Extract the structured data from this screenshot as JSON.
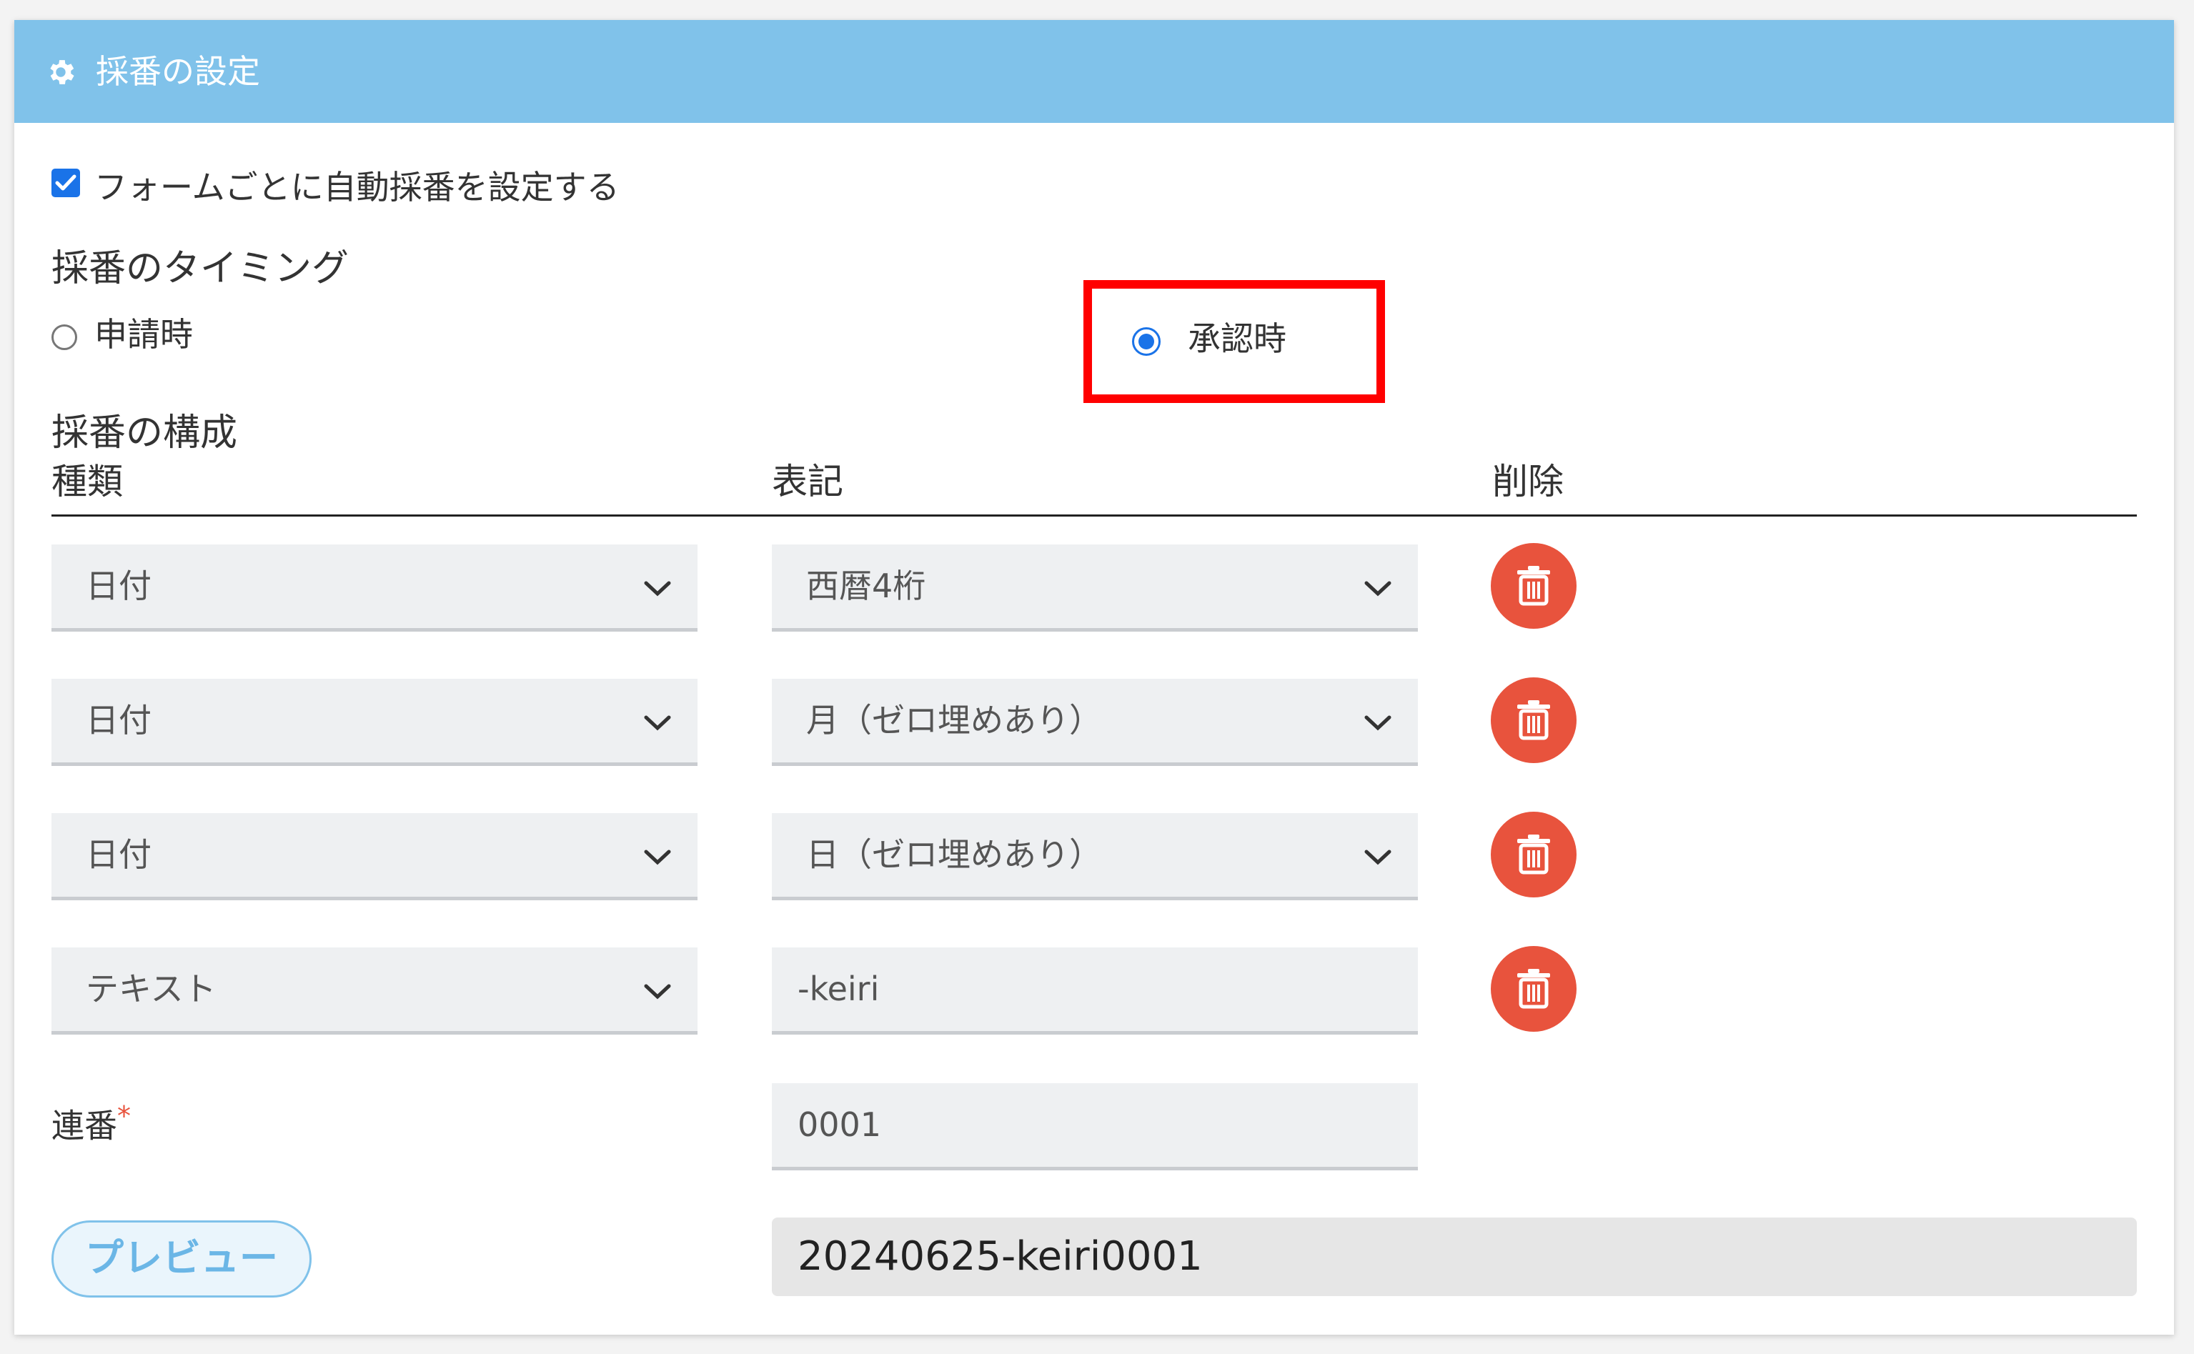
{
  "header": {
    "title": "採番の設定",
    "icon": "gear-icon"
  },
  "auto_numbering": {
    "label": "フォームごとに自動採番を設定する",
    "checked": true
  },
  "timing": {
    "label": "採番のタイミング",
    "options": [
      {
        "label": "申請時",
        "selected": false
      },
      {
        "label": "承認時",
        "selected": true
      }
    ]
  },
  "composition": {
    "label": "採番の構成",
    "columns": {
      "type": "種類",
      "notation": "表記",
      "delete": "削除"
    },
    "rows": [
      {
        "type": "日付",
        "notation": "西暦4桁"
      },
      {
        "type": "日付",
        "notation": "月（ゼロ埋めあり）"
      },
      {
        "type": "日付",
        "notation": "日（ゼロ埋めあり）"
      },
      {
        "type": "テキスト",
        "notation": "-keiri"
      }
    ]
  },
  "serial": {
    "label": "連番",
    "required_mark": "*",
    "value": "0001"
  },
  "preview": {
    "button_label": "プレビュー",
    "result": "20240625-keiri0001"
  },
  "colors": {
    "header": "#80c2ea",
    "accent": "#1a73e8",
    "delete": "#e8533d",
    "highlight": "#ff0000"
  }
}
